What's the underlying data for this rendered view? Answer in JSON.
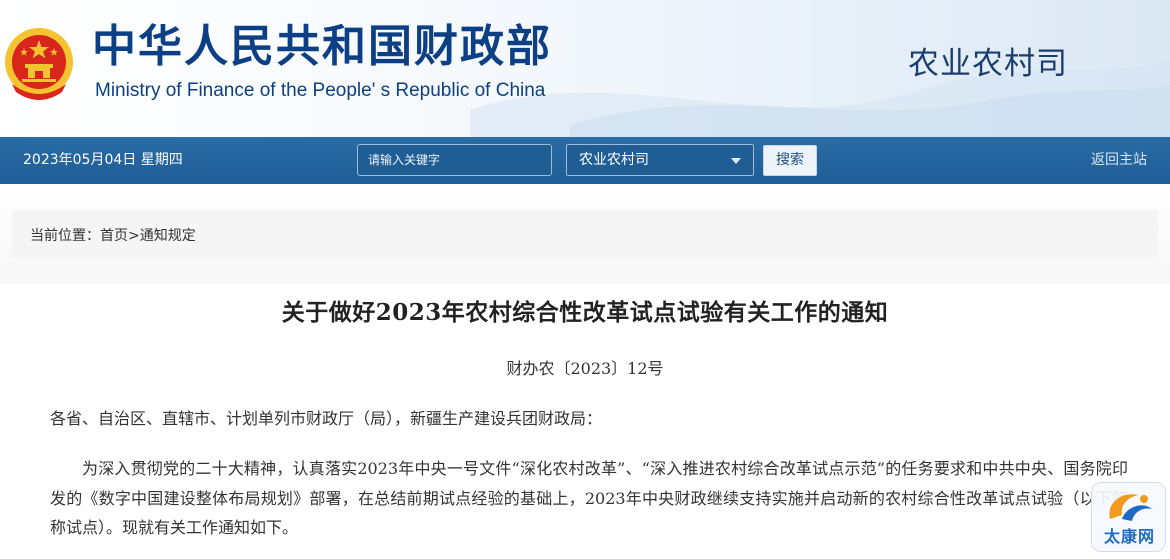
{
  "header": {
    "title_cn": "中华人民共和国财政部",
    "title_en": "Ministry of Finance of the People' s Republic of China",
    "department": "农业农村司"
  },
  "navbar": {
    "date": "2023年05月04日  星期四",
    "search_placeholder": "请输入关键字",
    "select_value": "农业农村司",
    "search_button": "搜索",
    "home_link": "返回主站"
  },
  "breadcrumb": {
    "prefix": "当前位置：",
    "home": "首页",
    "separator": ">",
    "current": "通知规定"
  },
  "article": {
    "title": "关于做好2023年农村综合性改革试点试验有关工作的通知",
    "doc_number": "财办农〔2023〕12号",
    "salutation": "各省、自治区、直辖市、计划单列市财政厅（局），新疆生产建设兵团财政局：",
    "body": "为深入贯彻党的二十大精神，认真落实2023年中央一号文件“深化农村改革”、“深入推进农村综合改革试点示范”的任务要求和中共中央、国务院印发的《数字中国建设整体布局规划》部署，在总结前期试点经验的基础上，2023年中央财政继续支持实施并启动新的农村综合性改革试点试验（以下简称试点）。现就有关工作通知如下。"
  },
  "watermark": {
    "text": "太康网"
  },
  "colors": {
    "brand_blue": "#0d3f84",
    "nav_blue": "#1f5d95",
    "emblem_red": "#d9261c",
    "emblem_gold": "#f4c430"
  }
}
